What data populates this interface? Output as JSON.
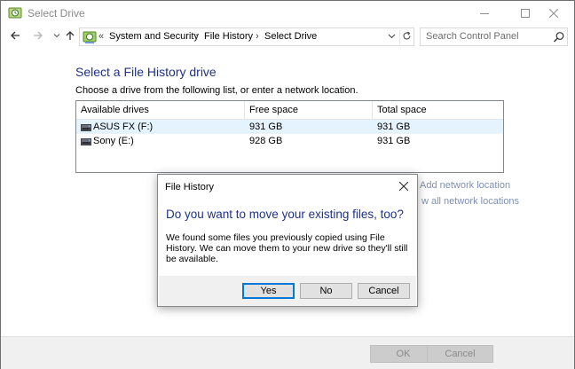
{
  "window": {
    "title": "Select Drive",
    "minimize_icon": "minimize-icon",
    "maximize_icon": "maximize-icon",
    "close_icon": "close-icon"
  },
  "nav": {
    "breadcrumb_prefix": "«",
    "crumbs": [
      "System and Security",
      "File History",
      "Select Drive"
    ],
    "separator": "›",
    "search_placeholder": "Search Control Panel"
  },
  "main": {
    "title": "Select a File History drive",
    "instructions": "Choose a drive from the following list, or enter a network location.",
    "columns": [
      "Available drives",
      "Free space",
      "Total space"
    ],
    "drives": [
      {
        "name": "ASUS FX (F:)",
        "free": "931 GB",
        "total": "931 GB",
        "selected": true
      },
      {
        "name": "Sony (E:)",
        "free": "928 GB",
        "total": "931 GB",
        "selected": false
      }
    ],
    "add_network_location": "Add network location",
    "show_network_locations_partial": "w all network locations"
  },
  "bottom": {
    "ok_label": "OK",
    "cancel_label": "Cancel"
  },
  "dialog": {
    "title": "File History",
    "heading": "Do you want to move your existing files, too?",
    "body": "We found some files you previously copied using File History. We can move them to your new drive so they'll still be available.",
    "yes_label": "Yes",
    "no_label": "No",
    "cancel_label": "Cancel"
  },
  "colors": {
    "heading_blue": "#1e3287",
    "selection": "#e5f3ff",
    "focus_blue": "#0078d7"
  }
}
